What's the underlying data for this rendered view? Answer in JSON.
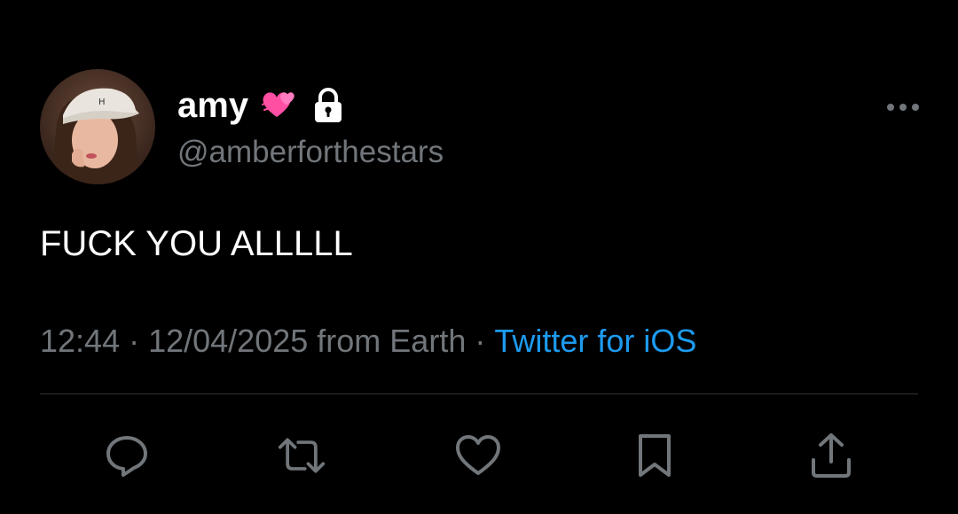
{
  "author": {
    "display_name": "amy",
    "emoji": "two-hearts-emoji",
    "protected_icon": "lock-icon",
    "handle": "@amberforthestars",
    "avatar": "profile-photo"
  },
  "tweet": {
    "text": "FUCK YOU ALLLLL"
  },
  "meta": {
    "time": "12:44",
    "separator": "·",
    "date": "12/04/2025",
    "location": "from Earth",
    "source": "Twitter for iOS"
  },
  "actions": [
    {
      "icon": "reply-icon"
    },
    {
      "icon": "retweet-icon"
    },
    {
      "icon": "like-icon"
    },
    {
      "icon": "bookmark-icon"
    },
    {
      "icon": "share-icon"
    }
  ],
  "colors": {
    "background": "#000000",
    "primary_text": "#ffffff",
    "secondary_text": "#71767b",
    "link": "#1d9bf0",
    "divider": "#2f3336",
    "emoji_pink": "#ff4fa3"
  }
}
